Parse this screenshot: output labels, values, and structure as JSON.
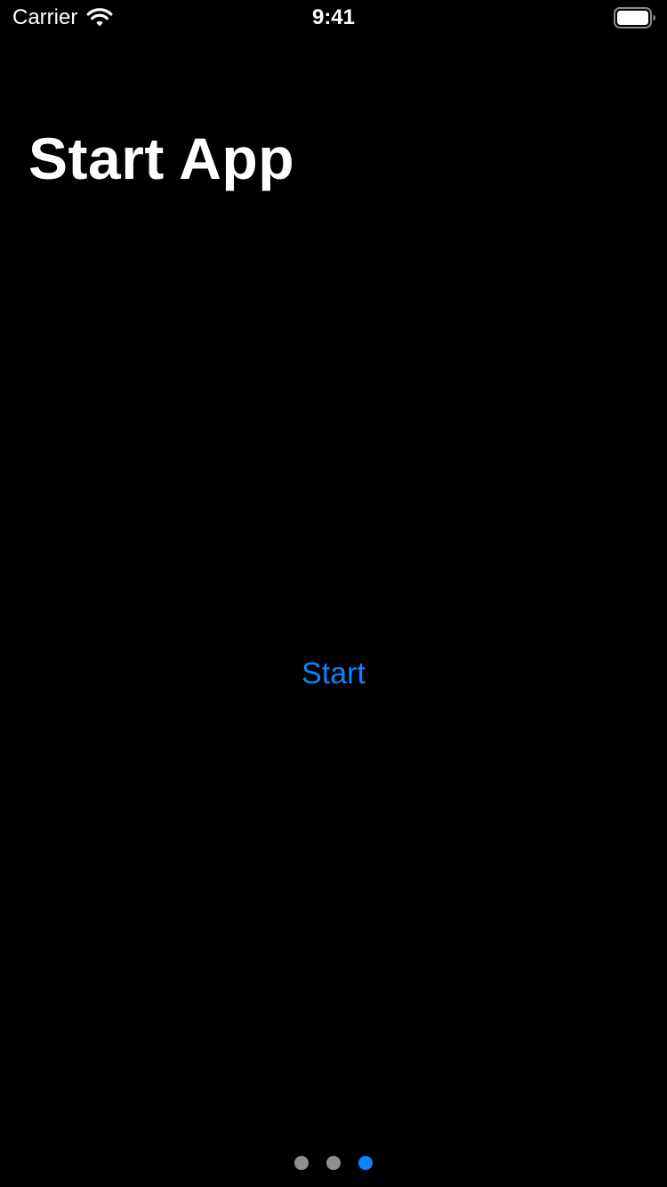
{
  "status_bar": {
    "carrier": "Carrier",
    "time": "9:41",
    "wifi_icon": "wifi-icon",
    "battery_icon": "battery-full-icon"
  },
  "title": "Start App",
  "start_button": {
    "label": "Start"
  },
  "page_control": {
    "page_count": 3,
    "current_page": 3,
    "active_color": "#0a84ff",
    "inactive_color": "#8e8e93"
  },
  "colors": {
    "background": "#000000",
    "text": "#ffffff",
    "accent": "#0a84ff"
  }
}
